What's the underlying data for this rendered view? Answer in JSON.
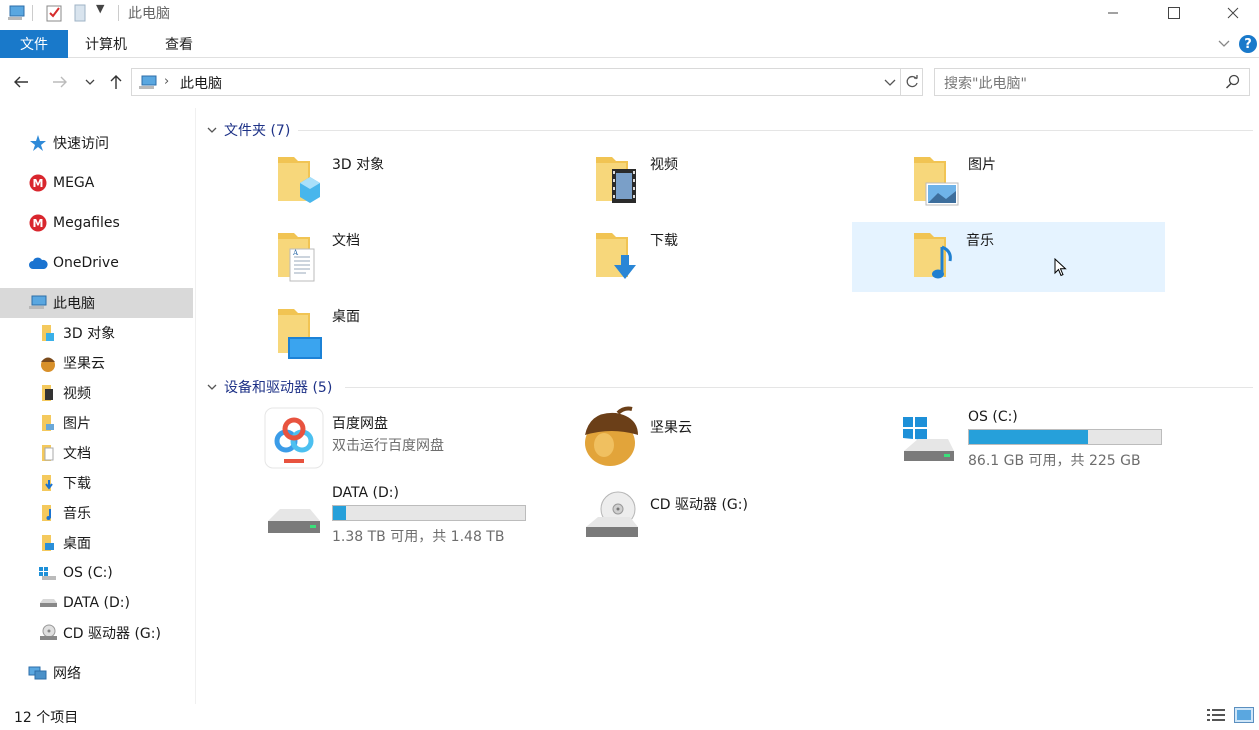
{
  "window": {
    "title": "此电脑"
  },
  "ribbon": {
    "tabs": {
      "file": "文件",
      "computer": "计算机",
      "view": "查看"
    }
  },
  "address": {
    "path": "此电脑"
  },
  "search": {
    "placeholder": "搜索\"此电脑\""
  },
  "nav": {
    "quick_access": "快速访问",
    "mega": "MEGA",
    "megafiles": "Megafiles",
    "onedrive": "OneDrive",
    "this_pc": "此电脑",
    "children": [
      "3D 对象",
      "坚果云",
      "视频",
      "图片",
      "文档",
      "下载",
      "音乐",
      "桌面",
      "OS (C:)",
      "DATA (D:)",
      "CD 驱动器 (G:)"
    ],
    "network": "网络"
  },
  "folders": {
    "header": "文件夹 (7)",
    "items": [
      "3D 对象",
      "视频",
      "图片",
      "文档",
      "下载",
      "音乐",
      "桌面"
    ]
  },
  "devices": {
    "header": "设备和驱动器 (5)",
    "baidu": {
      "name": "百度网盘",
      "sub": "双击运行百度网盘"
    },
    "jianguo": {
      "name": "坚果云"
    },
    "c": {
      "name": "OS (C:)",
      "free": "86.1 GB 可用，共 225 GB",
      "used_fraction": 0.62
    },
    "d": {
      "name": "DATA (D:)",
      "free": "1.38 TB 可用，共 1.48 TB",
      "used_fraction": 0.07
    },
    "g": {
      "name": "CD 驱动器 (G:)"
    }
  },
  "status": {
    "count": "12 个项目"
  }
}
